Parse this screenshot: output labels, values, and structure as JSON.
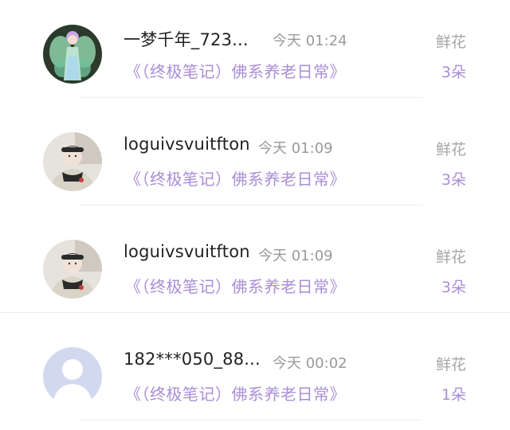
{
  "records": [
    {
      "avatar": "fairy-avatar",
      "name": "一梦千年_723...",
      "time": "今天 01:24",
      "title": "《（终极笔记）佛系养老日常》",
      "gift_type": "鲜花",
      "gift_count": "3朵"
    },
    {
      "avatar": "photo-avatar",
      "name": "loguivsvuitfton",
      "time": "今天 01:09",
      "title": "《（终极笔记）佛系养老日常》",
      "gift_type": "鲜花",
      "gift_count": "3朵"
    },
    {
      "avatar": "photo-avatar",
      "name": "loguivsvuitfton",
      "time": "今天 01:09",
      "title": "《（终极笔记）佛系养老日常》",
      "gift_type": "鲜花",
      "gift_count": "3朵"
    },
    {
      "avatar": "default-user-avatar",
      "name": "182***050_88...",
      "time": "今天 00:02",
      "title": "《（终极笔记）佛系养老日常》",
      "gift_type": "鲜花",
      "gift_count": "1朵"
    }
  ],
  "colors": {
    "accent": "#a98ed6",
    "name": "#222222",
    "muted": "#9a9a9a",
    "default_avatar_bg": "#d2d9ef"
  }
}
